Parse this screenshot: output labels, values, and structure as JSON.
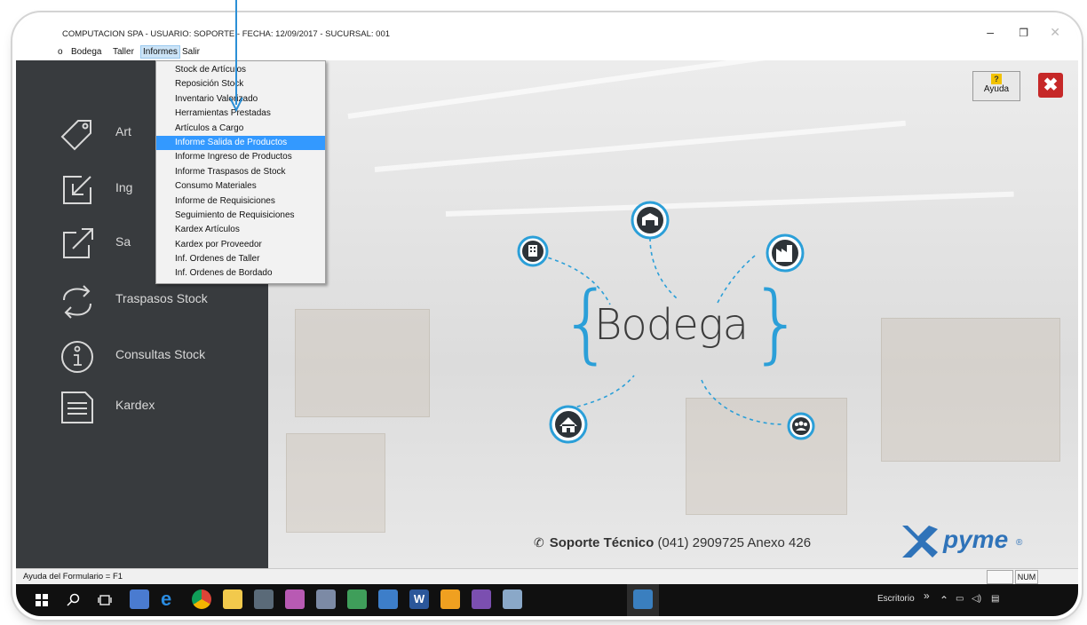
{
  "window": {
    "title": "COMPUTACION SPA - USUARIO: SOPORTE - FECHA: 12/09/2017 - SUCURSAL: 001",
    "minimize": "–",
    "maximize": "❐",
    "close": "✕"
  },
  "menubar": {
    "items": [
      {
        "label": "o"
      },
      {
        "label": "Bodega"
      },
      {
        "label": "Taller"
      },
      {
        "label": "Informes"
      },
      {
        "label": "Salir"
      }
    ]
  },
  "dropdown": {
    "selected_index": 5,
    "items": [
      "Stock de Artículos",
      "Reposición Stock",
      "Inventario Valorizado",
      "Herramientas Prestadas",
      "Artículos a Cargo",
      "Informe Salida de Productos",
      "Informe Ingreso de Productos",
      "Informe Traspasos de Stock",
      "Consumo Materiales",
      "Informe de Requisiciones",
      "Seguimiento de Requisiciones",
      "Kardex Artículos",
      "Kardex por Proveedor",
      "Inf. Ordenes de Taller",
      "Inf. Ordenes de Bordado"
    ]
  },
  "sidebar": {
    "items": [
      {
        "label": "Art",
        "icon": "tag-icon"
      },
      {
        "label": "Ing",
        "icon": "import-icon"
      },
      {
        "label": "Sa",
        "icon": "export-icon"
      },
      {
        "label": "Traspasos Stock",
        "icon": "transfer-icon"
      },
      {
        "label": "Consultas Stock",
        "icon": "info-icon"
      },
      {
        "label": "Kardex",
        "icon": "document-icon"
      }
    ]
  },
  "toolbar": {
    "help_label": "Ayuda",
    "help_glyph": "?",
    "exit_glyph": "✖"
  },
  "hub": {
    "word": "Bodega",
    "left_brace": "{",
    "right_brace": "}",
    "accent": "#2b9fd8",
    "nodes": [
      "warehouse-icon",
      "building-icon",
      "factory-icon",
      "home-icon",
      "users-icon"
    ]
  },
  "footer": {
    "support_bold": "Soporte Técnico",
    "support_rest": "(041) 2909725 Anexo 426",
    "logo_text": "pyme",
    "logo_mark": "®"
  },
  "statusbar": {
    "text": "Ayuda del Formulario = F1",
    "num": "NUM"
  },
  "taskbar": {
    "desktop_label": "Escritorio",
    "chevron": "»"
  }
}
